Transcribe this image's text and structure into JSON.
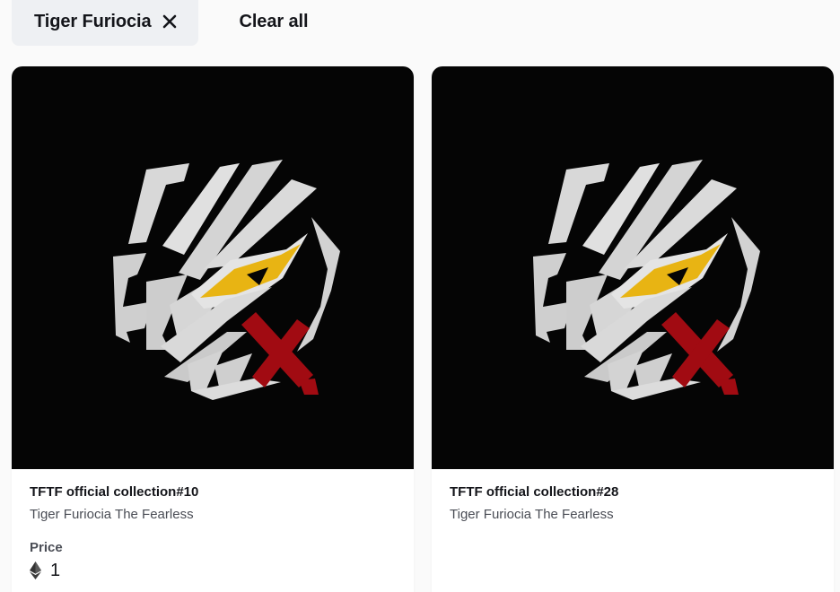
{
  "filters": {
    "active_chip_label": "Tiger Furiocia",
    "clear_all_label": "Clear all"
  },
  "cards": [
    {
      "title": "TFTF official collection#10",
      "subtitle": "Tiger Furiocia The Fearless",
      "price_label": "Price",
      "price_value": "1",
      "price_icon": "ethereum-icon"
    },
    {
      "title": "TFTF official collection#28",
      "subtitle": "Tiger Furiocia The Fearless"
    }
  ],
  "colors": {
    "chip_background": "#eef0f3",
    "media_background": "#050505",
    "tiger_stripe": "#d8d8d8",
    "tiger_eye": "#e8b413",
    "mark_red": "#a10b12"
  }
}
